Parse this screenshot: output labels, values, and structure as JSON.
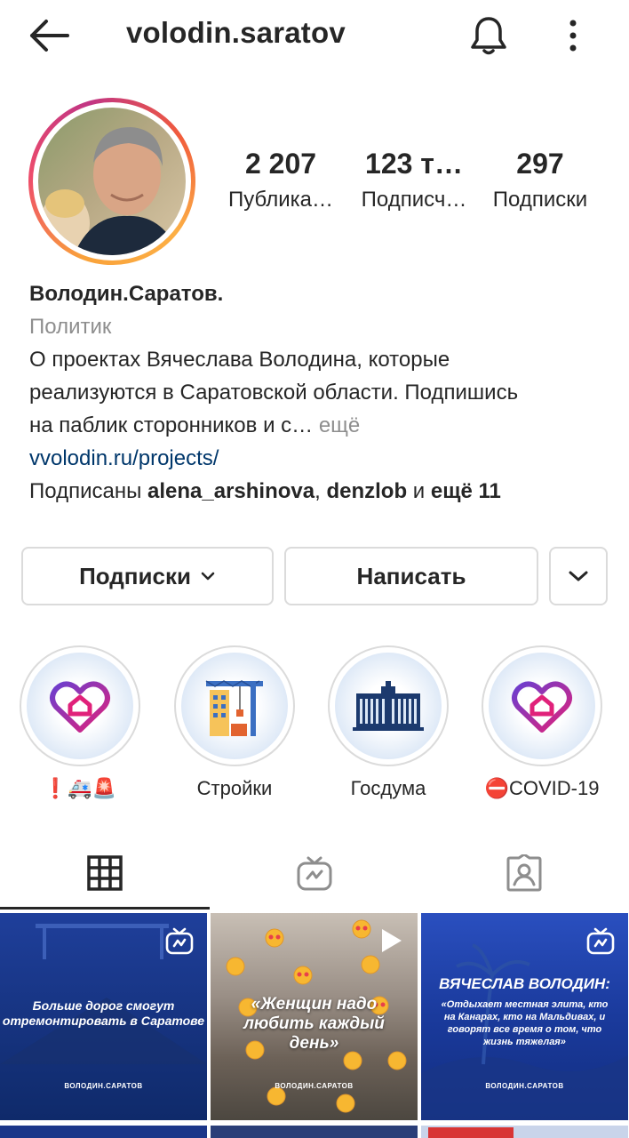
{
  "header": {
    "username": "volodin.saratov"
  },
  "stats": [
    {
      "value": "2 207",
      "label": "Публика…"
    },
    {
      "value": "123 т…",
      "label": "Подписч…"
    },
    {
      "value": "297",
      "label": "Подписки"
    }
  ],
  "bio": {
    "name": "Володин.Саратов.",
    "category": "Политик",
    "line1": "О проектах Вячеслава Володина, которые",
    "line2": "реализуются в Саратовской области. Подпишись",
    "line3": "на паблик сторонников и с…",
    "more": " ещё",
    "link": "vvolodin.ru/projects/",
    "followed_prefix": "Подписаны ",
    "followed_user1": "alena_arshinova",
    "followed_sep": ", ",
    "followed_user2": "denzlob",
    "followed_and": " и ",
    "followed_more": "ещё 11"
  },
  "actions": {
    "following_label": "Подписки",
    "message_label": "Написать"
  },
  "highlights": [
    {
      "label": "❗🚑🚨",
      "icon": "heart-house-icon"
    },
    {
      "label": "Стройки",
      "icon": "construction-crane-icon"
    },
    {
      "label": "Госдума",
      "icon": "duma-building-icon"
    },
    {
      "label": "⛔COVID-19",
      "icon": "heart-house-icon"
    }
  ],
  "tabs": [
    {
      "name": "grid",
      "icon": "grid-icon",
      "active": true
    },
    {
      "name": "igtv",
      "icon": "igtv-icon",
      "active": false
    },
    {
      "name": "tagged",
      "icon": "tagged-icon",
      "active": false
    }
  ],
  "posts": [
    {
      "text": "Больше дорог смогут отремонтировать в Саратове",
      "footer": "ВОЛОДИН.САРАТОВ",
      "badge": "igtv-icon"
    },
    {
      "text": "«Женщин надо любить каждый день»",
      "footer": "ВОЛОДИН.САРАТОВ",
      "badge": "play-icon"
    },
    {
      "title": "ВЯЧЕСЛАВ ВОЛОДИН:",
      "text": "«Отдыхает местная элита, кто на Канарах, кто на Мальдивах, и говорят все время о том, что жизнь тяжелая»",
      "footer": "ВОЛОДИН.САРАТОВ",
      "badge": "igtv-icon"
    }
  ],
  "colors": {
    "text": "#262626",
    "muted": "#8e8e8e",
    "link": "#00376b",
    "border": "#dbdbdb",
    "post_blue": "#1a3a9c"
  }
}
